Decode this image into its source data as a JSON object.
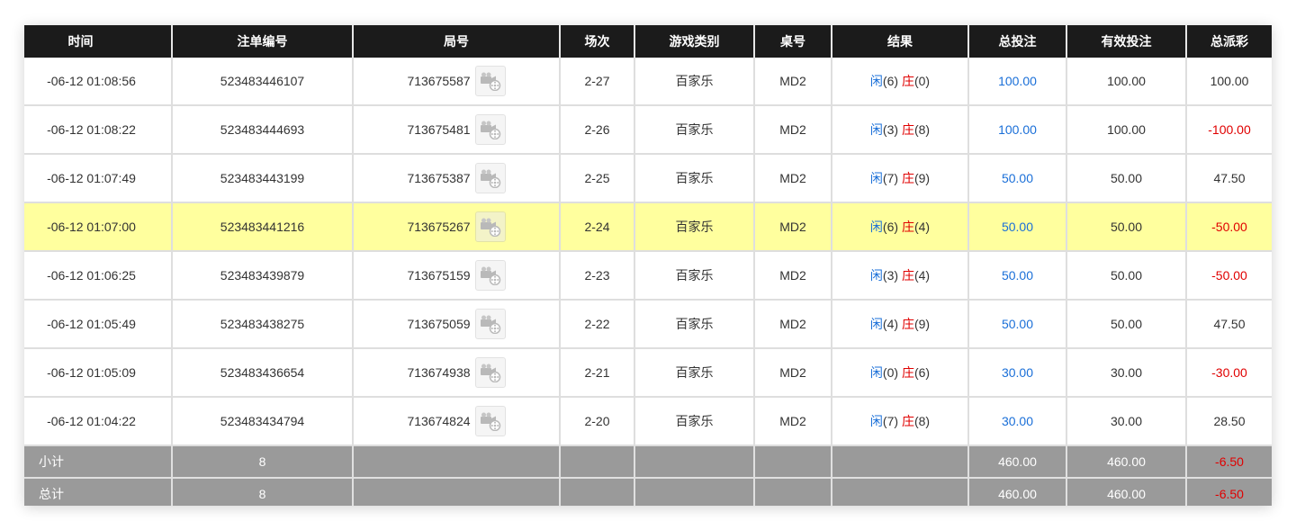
{
  "table": {
    "headers": {
      "time": "时间",
      "bet_id": "注单编号",
      "round": "局号",
      "shoe": "场次",
      "game_type": "游戏类别",
      "table_no": "桌号",
      "result": "结果",
      "total_bet": "总投注",
      "valid_bet": "有效投注",
      "payout": "总派彩"
    },
    "result_labels": {
      "player": "闲",
      "banker": "庄"
    },
    "video_icon": "video-camera-film-icon",
    "rows": [
      {
        "time": "-06-12 01:08:56",
        "bet_id": "523483446107",
        "round": "713675587",
        "shoe": "2-27",
        "game_type": "百家乐",
        "table_no": "MD2",
        "player_score": "(6)",
        "banker_score": "(0)",
        "total_bet": "100.00",
        "valid_bet": "100.00",
        "payout": "100.00",
        "payout_negative": false,
        "highlight": false
      },
      {
        "time": "-06-12 01:08:22",
        "bet_id": "523483444693",
        "round": "713675481",
        "shoe": "2-26",
        "game_type": "百家乐",
        "table_no": "MD2",
        "player_score": "(3)",
        "banker_score": "(8)",
        "total_bet": "100.00",
        "valid_bet": "100.00",
        "payout": "-100.00",
        "payout_negative": true,
        "highlight": false
      },
      {
        "time": "-06-12 01:07:49",
        "bet_id": "523483443199",
        "round": "713675387",
        "shoe": "2-25",
        "game_type": "百家乐",
        "table_no": "MD2",
        "player_score": "(7)",
        "banker_score": "(9)",
        "total_bet": "50.00",
        "valid_bet": "50.00",
        "payout": "47.50",
        "payout_negative": false,
        "highlight": false
      },
      {
        "time": "-06-12 01:07:00",
        "bet_id": "523483441216",
        "round": "713675267",
        "shoe": "2-24",
        "game_type": "百家乐",
        "table_no": "MD2",
        "player_score": "(6)",
        "banker_score": "(4)",
        "total_bet": "50.00",
        "valid_bet": "50.00",
        "payout": "-50.00",
        "payout_negative": true,
        "highlight": true
      },
      {
        "time": "-06-12 01:06:25",
        "bet_id": "523483439879",
        "round": "713675159",
        "shoe": "2-23",
        "game_type": "百家乐",
        "table_no": "MD2",
        "player_score": "(3)",
        "banker_score": "(4)",
        "total_bet": "50.00",
        "valid_bet": "50.00",
        "payout": "-50.00",
        "payout_negative": true,
        "highlight": false
      },
      {
        "time": "-06-12 01:05:49",
        "bet_id": "523483438275",
        "round": "713675059",
        "shoe": "2-22",
        "game_type": "百家乐",
        "table_no": "MD2",
        "player_score": "(4)",
        "banker_score": "(9)",
        "total_bet": "50.00",
        "valid_bet": "50.00",
        "payout": "47.50",
        "payout_negative": false,
        "highlight": false
      },
      {
        "time": "-06-12 01:05:09",
        "bet_id": "523483436654",
        "round": "713674938",
        "shoe": "2-21",
        "game_type": "百家乐",
        "table_no": "MD2",
        "player_score": "(0)",
        "banker_score": "(6)",
        "total_bet": "30.00",
        "valid_bet": "30.00",
        "payout": "-30.00",
        "payout_negative": true,
        "highlight": false
      },
      {
        "time": "-06-12 01:04:22",
        "bet_id": "523483434794",
        "round": "713674824",
        "shoe": "2-20",
        "game_type": "百家乐",
        "table_no": "MD2",
        "player_score": "(7)",
        "banker_score": "(8)",
        "total_bet": "30.00",
        "valid_bet": "30.00",
        "payout": "28.50",
        "payout_negative": false,
        "highlight": false
      }
    ],
    "subtotal": {
      "label": "小计",
      "count": "8",
      "total_bet": "460.00",
      "valid_bet": "460.00",
      "payout": "-6.50"
    },
    "grand_total": {
      "label": "总计",
      "count": "8",
      "total_bet": "460.00",
      "valid_bet": "460.00",
      "payout": "-6.50"
    }
  },
  "colors": {
    "header_bg": "#1b1b1b",
    "highlight_row": "#ffff9e",
    "total_row_bg": "#9a9a9a",
    "bet_blue": "#1a6fd8",
    "loss_red": "#e00000"
  }
}
